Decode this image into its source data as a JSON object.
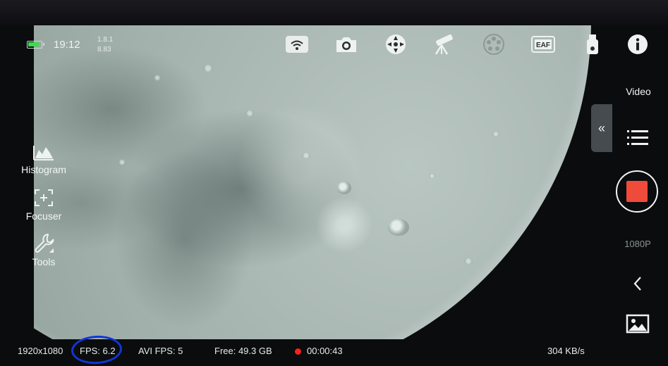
{
  "status": {
    "time": "19:12",
    "version_line1": "1.8.1",
    "version_line2": "8.83"
  },
  "top_icons": [
    "wifi-icon",
    "camera-icon",
    "mount-control-icon",
    "telescope-icon",
    "filter-wheel-icon",
    "eaf-icon",
    "usb-drive-icon",
    "info-icon"
  ],
  "top_icon_labels": {
    "eaf": "EAF"
  },
  "sidebar": {
    "items": [
      {
        "label": "Histogram",
        "icon": "histogram-icon"
      },
      {
        "label": "Focuser",
        "icon": "focuser-icon"
      },
      {
        "label": "Tools",
        "icon": "wrench-icon"
      }
    ]
  },
  "right_panel": {
    "collapse_glyph": "«",
    "mode_label": "Video",
    "resolution_label": "1080P"
  },
  "bottom_bar": {
    "resolution": "1920x1080",
    "fps": "FPS: 6.2",
    "avi_fps": "AVI FPS: 5",
    "free_space": "Free: 49.3 GB",
    "rec_time": "00:00:43",
    "transfer_rate": "304 KB/s"
  },
  "colors": {
    "record": "#ef4b3a",
    "battery": "#3bdc4e",
    "annotation": "#1136d6",
    "rec_dot": "#ff1f1f"
  }
}
